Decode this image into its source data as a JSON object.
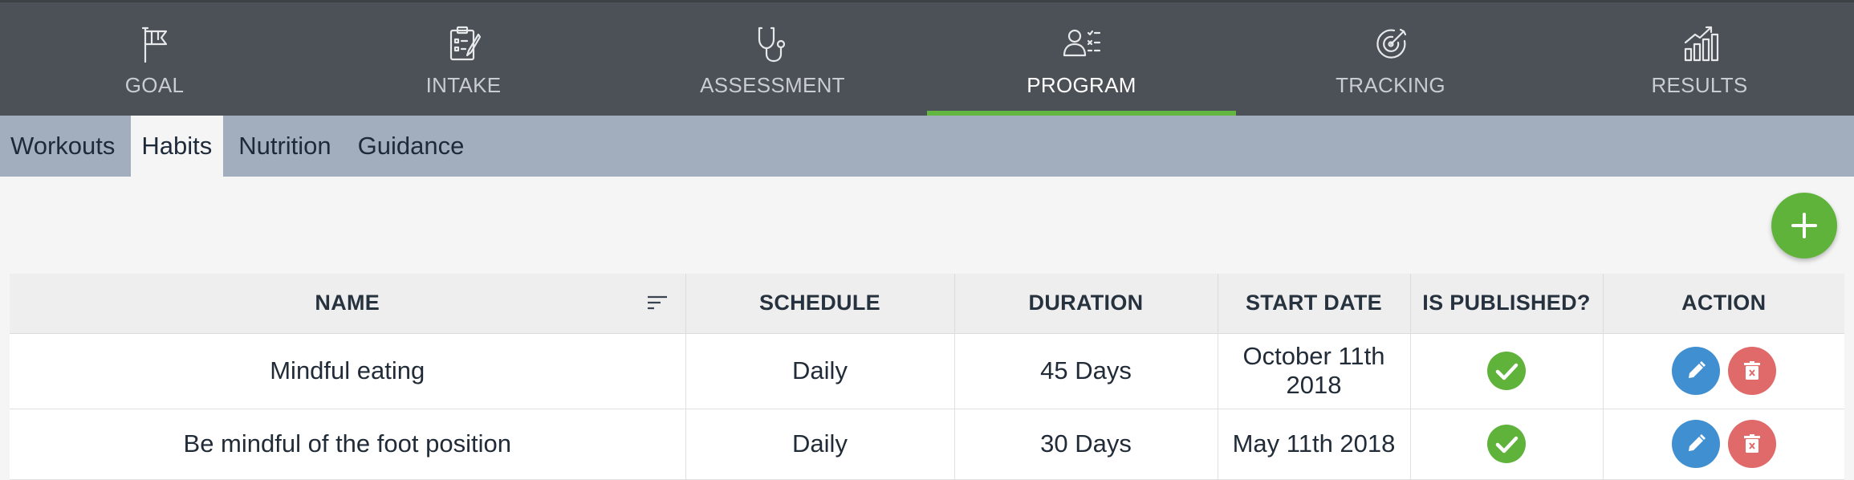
{
  "nav": {
    "items": [
      {
        "label": "GOAL",
        "icon": "flag-icon"
      },
      {
        "label": "INTAKE",
        "icon": "clipboard-icon"
      },
      {
        "label": "ASSESSMENT",
        "icon": "stethoscope-icon"
      },
      {
        "label": "PROGRAM",
        "icon": "user-list-icon",
        "active": true
      },
      {
        "label": "TRACKING",
        "icon": "target-icon"
      },
      {
        "label": "RESULTS",
        "icon": "bar-chart-icon"
      }
    ],
    "active_color": "#63b640"
  },
  "subtabs": [
    "Workouts",
    "Habits",
    "Nutrition",
    "Guidance"
  ],
  "active_subtab": "Habits",
  "table": {
    "headers": [
      "NAME",
      "SCHEDULE",
      "DURATION",
      "START DATE",
      "IS PUBLISHED?",
      "ACTION"
    ],
    "rows": [
      {
        "name": "Mindful eating",
        "schedule": "Daily",
        "duration": "45 Days",
        "start_date": "October 11th 2018",
        "published": true
      },
      {
        "name": "Be mindful of the foot position",
        "schedule": "Daily",
        "duration": "30 Days",
        "start_date": "May 11th 2018",
        "published": true
      }
    ]
  },
  "colors": {
    "green": "#5fb33b",
    "edit": "#3f8fd1",
    "delete": "#e06a6a"
  }
}
